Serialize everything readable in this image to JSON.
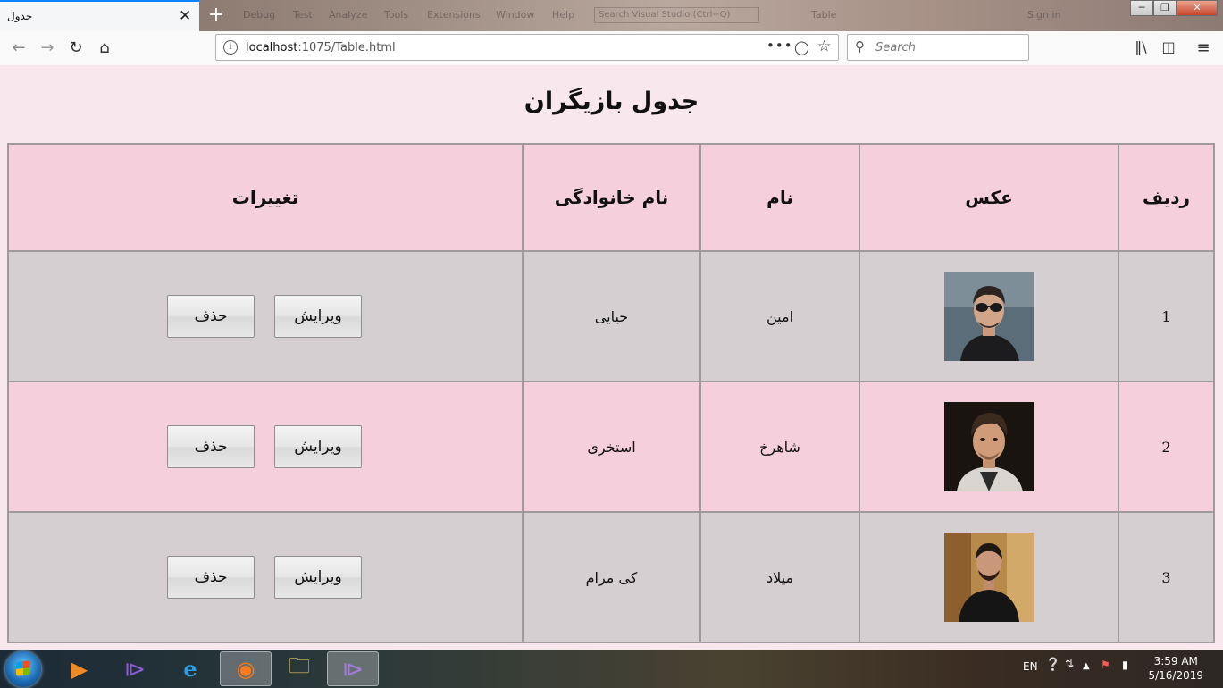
{
  "browser": {
    "tab_title": "جدول",
    "tab_close": "✕",
    "new_tab": "+",
    "url_host": "localhost",
    "url_rest": ":1075/Table.html",
    "search_placeholder": "Search",
    "background_menus": [
      "Debug",
      "Test",
      "Analyze",
      "Tools",
      "Extensions",
      "Window",
      "Help"
    ],
    "background_search": "Search Visual Studio (Ctrl+Q)",
    "background_title": "Table",
    "background_signin": "Sign in"
  },
  "icons": {
    "back": "back-arrow-icon",
    "forward": "forward-arrow-icon",
    "reload": "reload-icon",
    "home": "home-icon",
    "info": "info-icon",
    "more": "more-actions-icon",
    "pocket": "pocket-icon",
    "bookmark": "bookmark-star-icon",
    "search": "search-icon",
    "library": "library-icon",
    "sidebar": "sidebar-icon",
    "menu": "hamburger-menu-icon"
  },
  "page": {
    "title": "جدول بازیگران",
    "headers": {
      "row": "ردیف",
      "photo": "عکس",
      "first_name": "نام",
      "last_name": "نام خانوادگی",
      "changes": "تغییرات"
    },
    "rows": [
      {
        "num": "1",
        "first_name": "امین",
        "last_name": "حیایی",
        "edit": "ویرایش",
        "delete": "حذف"
      },
      {
        "num": "2",
        "first_name": "شاهرخ",
        "last_name": "استخری",
        "edit": "ویرایش",
        "delete": "حذف"
      },
      {
        "num": "3",
        "first_name": "میلاد",
        "last_name": "کی مرام",
        "edit": "ویرایش",
        "delete": "حذف"
      }
    ]
  },
  "taskbar": {
    "language": "EN",
    "time": "3:59 AM",
    "date": "5/16/2019"
  },
  "colors": {
    "header_bg": "#f5d0dc",
    "row_odd_bg": "#d5cfd2",
    "row_even_bg": "#f5d0dc",
    "page_bg": "#f8e8ee",
    "tab_accent": "#0a84ff"
  }
}
